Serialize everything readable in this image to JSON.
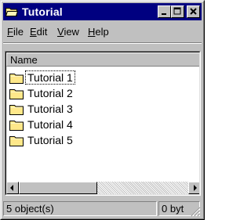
{
  "window": {
    "title": "Tutorial",
    "icon": "folder-open-icon",
    "controls": {
      "minimize": "minimize-icon",
      "maximize": "maximize-icon",
      "close": "close-icon"
    }
  },
  "menu": [
    {
      "u": "F",
      "rest": "ile"
    },
    {
      "u": "E",
      "rest": "dit"
    },
    {
      "u": "V",
      "rest": "iew"
    },
    {
      "u": "H",
      "rest": "elp"
    }
  ],
  "list": {
    "column_header": "Name",
    "items": [
      {
        "label": "Tutorial 1",
        "icon": "folder-icon",
        "focused": true
      },
      {
        "label": "Tutorial 2",
        "icon": "folder-icon"
      },
      {
        "label": "Tutorial 3",
        "icon": "folder-icon"
      },
      {
        "label": "Tutorial 4",
        "icon": "folder-icon"
      },
      {
        "label": "Tutorial 5",
        "icon": "folder-icon"
      }
    ]
  },
  "status": {
    "objects": "5 object(s)",
    "size": "0 byt"
  },
  "colors": {
    "titlebar": "#000080",
    "face": "#c0c0c0",
    "folder": "#ffe88a"
  }
}
